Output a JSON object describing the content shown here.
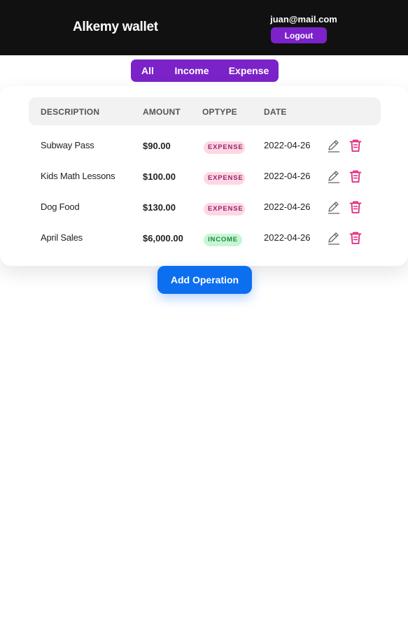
{
  "app": {
    "title": "Alkemy wallet"
  },
  "user": {
    "email": "juan@mail.com",
    "logout_label": "Logout"
  },
  "filters": [
    "All",
    "Income",
    "Expense"
  ],
  "table": {
    "columns": [
      "DESCRIPTION",
      "AMOUNT",
      "OPTYPE",
      "DATE"
    ],
    "rows": [
      {
        "description": "Subway Pass",
        "amount": "$90.00",
        "optype": "EXPENSE",
        "date": "2022-04-26"
      },
      {
        "description": "Kids Math Lessons",
        "amount": "$100.00",
        "optype": "EXPENSE",
        "date": "2022-04-26"
      },
      {
        "description": "Dog Food",
        "amount": "$130.00",
        "optype": "EXPENSE",
        "date": "2022-04-26"
      },
      {
        "description": "April Sales",
        "amount": "$6,000.00",
        "optype": "INCOME",
        "date": "2022-04-26"
      }
    ]
  },
  "actions": {
    "add_label": "Add Operation"
  },
  "icons": {
    "edit": "pencil-icon",
    "delete": "trash-icon"
  },
  "colors": {
    "header_bg": "#111111",
    "accent": "#7b22c9",
    "primary_button": "#0b6ff0",
    "delete_icon": "#e0287c",
    "expense_badge_bg": "#fed7e2",
    "income_badge_bg": "#c6f6d5"
  }
}
